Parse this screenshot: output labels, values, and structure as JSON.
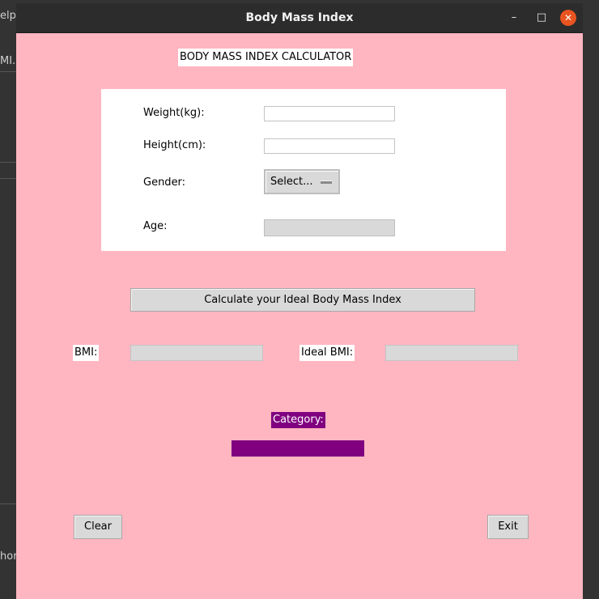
{
  "window": {
    "title": "Body Mass Index",
    "controls": {
      "minimize": "–",
      "maximize": "□",
      "close": "✕"
    }
  },
  "background_app": {
    "fragments": [
      "elp",
      "MI.",
      "hor"
    ]
  },
  "form": {
    "heading": "BODY MASS INDEX CALCULATOR",
    "weight_label": "Weight(kg):",
    "weight_value": "",
    "height_label": "Height(cm):",
    "height_value": "",
    "gender_label": "Gender:",
    "gender_selected": "Select...",
    "age_label": "Age:",
    "age_value": ""
  },
  "calculate_button": "Calculate your Ideal Body Mass Index",
  "results": {
    "bmi_label": "BMI:",
    "bmi_value": "",
    "ideal_bmi_label": "Ideal BMI:",
    "ideal_bmi_value": "",
    "category_label": "Category:",
    "category_value": ""
  },
  "actions": {
    "clear": "Clear",
    "exit": "Exit"
  },
  "colors": {
    "window_bg": "#ffb6c1",
    "category_bg": "#800080",
    "titlebar": "#2c2c2c",
    "close_button": "#e95420"
  }
}
